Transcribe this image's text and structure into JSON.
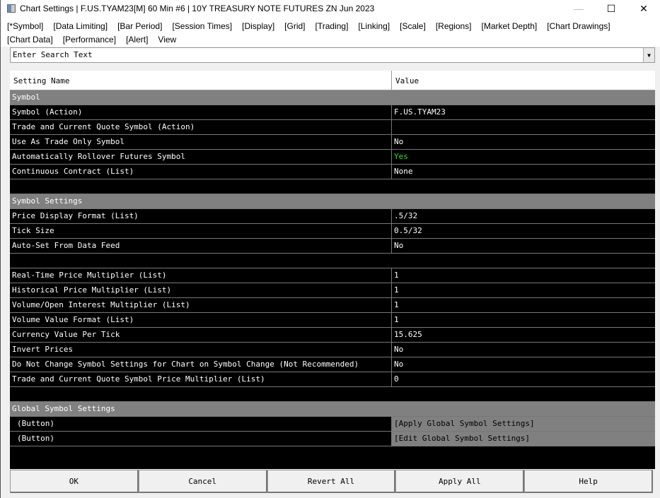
{
  "window": {
    "title": "Chart Settings | F.US.TYAM23[M]  60 Min  #6 | 10Y TREASURY NOTE FUTURES ZN Jun 2023",
    "minimize": "—",
    "maximize": "☐",
    "close": "✕"
  },
  "menu": [
    "[*Symbol]",
    "[Data Limiting]",
    "[Bar Period]",
    "[Session Times]",
    "[Display]",
    "[Grid]",
    "[Trading]",
    "[Linking]",
    "[Scale]",
    "[Regions]",
    "[Market Depth]",
    "[Chart Drawings]",
    "[Chart Data]",
    "[Performance]",
    "[Alert]",
    "View"
  ],
  "search": {
    "value": "Enter Search Text",
    "dropdown_icon": "▼"
  },
  "table": {
    "headers": [
      "Setting Name",
      "Value"
    ],
    "rows": [
      {
        "type": "group",
        "name": "Symbol"
      },
      {
        "name": "Symbol (Action)",
        "value": "F.US.TYAM23"
      },
      {
        "name": "Trade and Current Quote Symbol (Action)",
        "value": ""
      },
      {
        "name": "Use As Trade Only Symbol",
        "value": "No"
      },
      {
        "name": "Automatically Rollover Futures Symbol",
        "value": "Yes",
        "color": "#22e622"
      },
      {
        "name": "Continuous Contract (List)",
        "value": "None"
      },
      {
        "type": "blank"
      },
      {
        "type": "group",
        "name": "Symbol Settings"
      },
      {
        "name": "Price Display Format (List)",
        "value": ".5/32"
      },
      {
        "name": "Tick Size",
        "value": "0.5/32"
      },
      {
        "name": "Auto-Set From Data Feed",
        "value": "No"
      },
      {
        "type": "blank"
      },
      {
        "name": "Real-Time Price Multiplier (List)",
        "value": "1"
      },
      {
        "name": "Historical Price Multiplier (List)",
        "value": "1"
      },
      {
        "name": "Volume/Open Interest Multiplier (List)",
        "value": "1"
      },
      {
        "name": "Volume Value Format (List)",
        "value": "1"
      },
      {
        "name": "Currency Value Per Tick",
        "value": "15.625"
      },
      {
        "name": "Invert Prices",
        "value": "No"
      },
      {
        "name": "Do Not Change Symbol Settings for Chart on Symbol Change (Not Recommended)",
        "value": "No"
      },
      {
        "name": "Trade and Current Quote Symbol Price Multiplier (List)",
        "value": "0"
      },
      {
        "type": "blank"
      },
      {
        "type": "group",
        "name": "Global Symbol Settings"
      },
      {
        "type": "btn",
        "name": "(Button)",
        "value": "[Apply Global Symbol Settings]"
      },
      {
        "type": "btn",
        "name": "(Button)",
        "value": "[Edit Global Symbol Settings]"
      }
    ]
  },
  "buttons": [
    "OK",
    "Cancel",
    "Revert All",
    "Apply All",
    "Help"
  ]
}
